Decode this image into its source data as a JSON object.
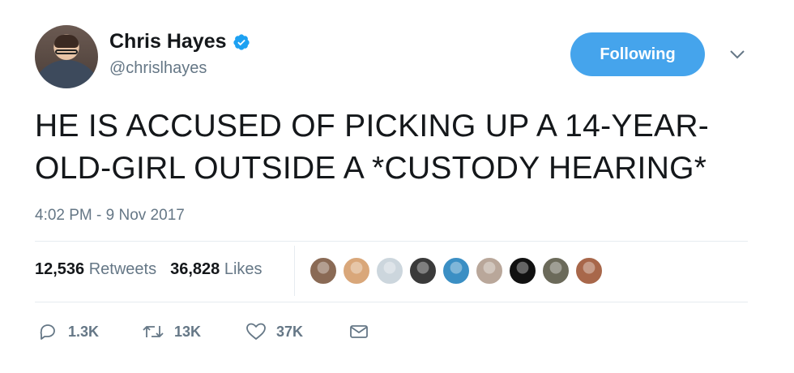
{
  "author": {
    "name": "Chris Hayes",
    "handle": "@chrislhayes",
    "verified": true
  },
  "follow_button": {
    "label": "Following",
    "color": "#45a4ec"
  },
  "tweet": {
    "line1": "HE IS ACCUSED OF PICKING UP A 14-YEAR-",
    "line2": "OLD-GIRL OUTSIDE A *CUSTODY HEARING*",
    "timestamp": "4:02 PM - 9 Nov 2017"
  },
  "stats": {
    "retweets_count": "12,536",
    "retweets_label": "Retweets",
    "likes_count": "36,828",
    "likes_label": "Likes"
  },
  "likers": [
    {
      "icon": "liker-avatar",
      "color": "#8a6a55"
    },
    {
      "icon": "liker-avatar",
      "color": "#d9a77a"
    },
    {
      "icon": "default-avatar",
      "color": "#ccd6dd"
    },
    {
      "icon": "liker-avatar",
      "color": "#3a3a3a"
    },
    {
      "icon": "liker-avatar",
      "color": "#3b8fc4"
    },
    {
      "icon": "liker-avatar",
      "color": "#b9a79a"
    },
    {
      "icon": "eagles-logo",
      "color": "#111111"
    },
    {
      "icon": "liker-avatar",
      "color": "#6b6a5a"
    },
    {
      "icon": "liker-avatar",
      "color": "#a8674a"
    }
  ],
  "actions": {
    "replies": "1.3K",
    "retweets": "13K",
    "likes": "37K"
  }
}
